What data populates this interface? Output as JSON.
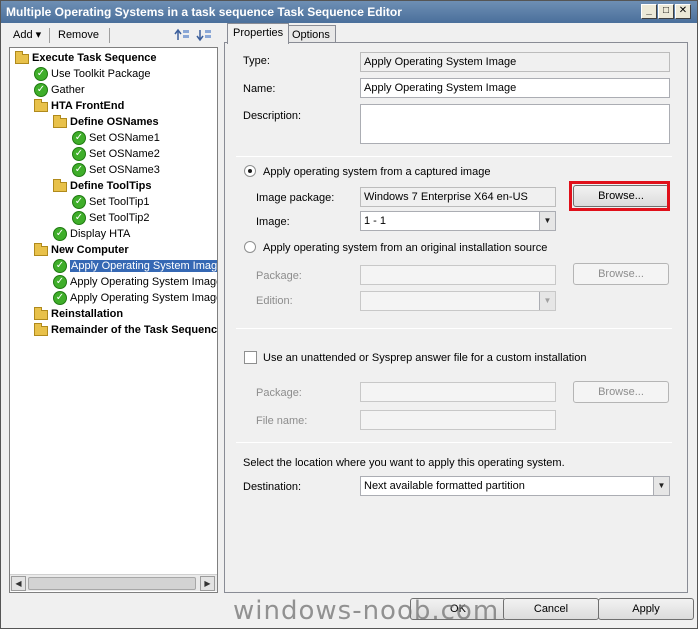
{
  "window": {
    "title": "Multiple Operating Systems in a task sequence Task Sequence Editor"
  },
  "titlebar_buttons": {
    "minimize": "_",
    "maximize": "□",
    "close": "✕"
  },
  "toolbar": {
    "add": "Add",
    "add_arrow": "▾",
    "remove": "Remove"
  },
  "tree": {
    "items": [
      {
        "label": "Execute Task Sequence",
        "icon": "folder-icon"
      },
      {
        "label": "Use Toolkit Package",
        "icon": "check-icon"
      },
      {
        "label": "Gather",
        "icon": "check-icon"
      },
      {
        "label": "HTA FrontEnd",
        "icon": "folder-icon"
      },
      {
        "label": "Define OSNames",
        "icon": "folder-icon"
      },
      {
        "label": "Set OSName1",
        "icon": "check-icon"
      },
      {
        "label": "Set OSName2",
        "icon": "check-icon"
      },
      {
        "label": "Set OSName3",
        "icon": "check-icon"
      },
      {
        "label": "Define ToolTips",
        "icon": "folder-icon"
      },
      {
        "label": "Set ToolTip1",
        "icon": "check-icon"
      },
      {
        "label": "Set ToolTip2",
        "icon": "check-icon"
      },
      {
        "label": "Display HTA",
        "icon": "check-icon"
      },
      {
        "label": "New Computer",
        "icon": "folder-icon"
      },
      {
        "label": "Apply Operating System Image",
        "icon": "check-icon"
      },
      {
        "label": "Apply Operating System Image",
        "icon": "check-icon"
      },
      {
        "label": "Apply Operating System Image",
        "icon": "check-icon"
      },
      {
        "label": "Reinstallation",
        "icon": "folder-icon"
      },
      {
        "label": "Remainder of the Task Sequence",
        "icon": "folder-icon"
      }
    ],
    "selected": "Apply Operating System Image",
    "check_glyph": "✓"
  },
  "tabs": {
    "properties": "Properties",
    "options": "Options"
  },
  "props": {
    "type_label": "Type:",
    "type_value": "Apply Operating System Image",
    "name_label": "Name:",
    "name_value": "Apply Operating System Image",
    "description_label": "Description:",
    "description_value": "",
    "radio_captured": "Apply operating system from a captured image",
    "image_package_label": "Image package:",
    "image_package_value": "Windows 7 Enterprise X64 en-US",
    "browse": "Browse...",
    "image_label": "Image:",
    "image_value": "1 - 1",
    "radio_original": "Apply operating system from an original installation source",
    "package_label": "Package:",
    "edition_label": "Edition:",
    "unattend_checkbox": "Use an unattended or Sysprep answer file for a custom installation",
    "unattend_package_label": "Package:",
    "file_name_label": "File name:",
    "location_text": "Select the location where you want to apply this operating system.",
    "destination_label": "Destination:",
    "destination_value": "Next available formatted partition"
  },
  "buttons": {
    "ok": "OK",
    "cancel": "Cancel",
    "apply": "Apply"
  },
  "watermark": "windows-noob.com",
  "colors": {
    "highlight_box": "#e0101a",
    "selection": "#3568b4",
    "title_bar": "#4a6f9b"
  }
}
